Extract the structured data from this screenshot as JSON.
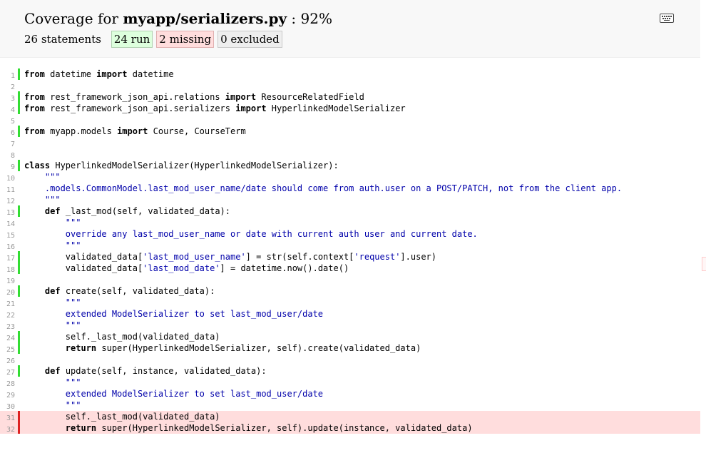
{
  "header": {
    "title_prefix": "Coverage for ",
    "file_name": "myapp/serializers.py",
    "title_suffix": " : 92%",
    "statements": "26 statements",
    "run_button": "24 run",
    "missing_button": "2 missing",
    "excluded_button": "0 excluded",
    "keyboard_icon": "keyboard-icon"
  },
  "colors": {
    "run_bar": "#33dd33",
    "missing_bar": "#dd2222",
    "missing_bg": "#ffdddd",
    "run_bg": "#ddffdd",
    "string": "#0000aa"
  },
  "lines": [
    {
      "n": "1",
      "status": "run",
      "segs": [
        [
          "k",
          "from"
        ],
        [
          "t",
          " datetime "
        ],
        [
          "k",
          "import"
        ],
        [
          "t",
          " datetime"
        ]
      ]
    },
    {
      "n": "2",
      "status": "",
      "segs": []
    },
    {
      "n": "3",
      "status": "run",
      "segs": [
        [
          "k",
          "from"
        ],
        [
          "t",
          " rest_framework_json_api.relations "
        ],
        [
          "k",
          "import"
        ],
        [
          "t",
          " ResourceRelatedField"
        ]
      ]
    },
    {
      "n": "4",
      "status": "run",
      "segs": [
        [
          "k",
          "from"
        ],
        [
          "t",
          " rest_framework_json_api.serializers "
        ],
        [
          "k",
          "import"
        ],
        [
          "t",
          " HyperlinkedModelSerializer"
        ]
      ]
    },
    {
      "n": "5",
      "status": "",
      "segs": []
    },
    {
      "n": "6",
      "status": "run",
      "segs": [
        [
          "k",
          "from"
        ],
        [
          "t",
          " myapp.models "
        ],
        [
          "k",
          "import"
        ],
        [
          "t",
          " Course, CourseTerm"
        ]
      ]
    },
    {
      "n": "7",
      "status": "",
      "segs": []
    },
    {
      "n": "8",
      "status": "",
      "segs": []
    },
    {
      "n": "9",
      "status": "run",
      "segs": [
        [
          "k",
          "class"
        ],
        [
          "t",
          " HyperlinkedModelSerializer(HyperlinkedModelSerializer):"
        ]
      ]
    },
    {
      "n": "10",
      "status": "",
      "segs": [
        [
          "t",
          "    "
        ],
        [
          "s",
          "\"\"\""
        ]
      ]
    },
    {
      "n": "11",
      "status": "",
      "segs": [
        [
          "t",
          "    "
        ],
        [
          "s",
          ".models.CommonModel.last_mod_user_name/date should come from auth.user on a POST/PATCH, not from the client app."
        ]
      ]
    },
    {
      "n": "12",
      "status": "",
      "segs": [
        [
          "t",
          "    "
        ],
        [
          "s",
          "\"\"\""
        ]
      ]
    },
    {
      "n": "13",
      "status": "run",
      "segs": [
        [
          "t",
          "    "
        ],
        [
          "k",
          "def"
        ],
        [
          "t",
          " _last_mod(self, validated_data):"
        ]
      ]
    },
    {
      "n": "14",
      "status": "",
      "segs": [
        [
          "t",
          "        "
        ],
        [
          "s",
          "\"\"\""
        ]
      ]
    },
    {
      "n": "15",
      "status": "",
      "segs": [
        [
          "t",
          "        "
        ],
        [
          "s",
          "override any last_mod_user_name or date with current auth user and current date."
        ]
      ]
    },
    {
      "n": "16",
      "status": "",
      "segs": [
        [
          "t",
          "        "
        ],
        [
          "s",
          "\"\"\""
        ]
      ]
    },
    {
      "n": "17",
      "status": "run",
      "segs": [
        [
          "t",
          "        validated_data["
        ],
        [
          "s",
          "'last_mod_user_name'"
        ],
        [
          "t",
          "] = str(self.context["
        ],
        [
          "s",
          "'request'"
        ],
        [
          "t",
          "].user)"
        ]
      ]
    },
    {
      "n": "18",
      "status": "run",
      "segs": [
        [
          "t",
          "        validated_data["
        ],
        [
          "s",
          "'last_mod_date'"
        ],
        [
          "t",
          "] = datetime.now().date()"
        ]
      ]
    },
    {
      "n": "19",
      "status": "",
      "segs": []
    },
    {
      "n": "20",
      "status": "run",
      "segs": [
        [
          "t",
          "    "
        ],
        [
          "k",
          "def"
        ],
        [
          "t",
          " create(self, validated_data):"
        ]
      ]
    },
    {
      "n": "21",
      "status": "",
      "segs": [
        [
          "t",
          "        "
        ],
        [
          "s",
          "\"\"\""
        ]
      ]
    },
    {
      "n": "22",
      "status": "",
      "segs": [
        [
          "t",
          "        "
        ],
        [
          "s",
          "extended ModelSerializer to set last_mod_user/date"
        ]
      ]
    },
    {
      "n": "23",
      "status": "",
      "segs": [
        [
          "t",
          "        "
        ],
        [
          "s",
          "\"\"\""
        ]
      ]
    },
    {
      "n": "24",
      "status": "run",
      "segs": [
        [
          "t",
          "        self._last_mod(validated_data)"
        ]
      ]
    },
    {
      "n": "25",
      "status": "run",
      "segs": [
        [
          "t",
          "        "
        ],
        [
          "k",
          "return"
        ],
        [
          "t",
          " super(HyperlinkedModelSerializer, self).create(validated_data)"
        ]
      ]
    },
    {
      "n": "26",
      "status": "",
      "segs": []
    },
    {
      "n": "27",
      "status": "run",
      "segs": [
        [
          "t",
          "    "
        ],
        [
          "k",
          "def"
        ],
        [
          "t",
          " update(self, instance, validated_data):"
        ]
      ]
    },
    {
      "n": "28",
      "status": "",
      "segs": [
        [
          "t",
          "        "
        ],
        [
          "s",
          "\"\"\""
        ]
      ]
    },
    {
      "n": "29",
      "status": "",
      "segs": [
        [
          "t",
          "        "
        ],
        [
          "s",
          "extended ModelSerializer to set last_mod_user/date"
        ]
      ]
    },
    {
      "n": "30",
      "status": "",
      "segs": [
        [
          "t",
          "        "
        ],
        [
          "s",
          "\"\"\""
        ]
      ]
    },
    {
      "n": "31",
      "status": "mis",
      "segs": [
        [
          "t",
          "        self._last_mod(validated_data)"
        ]
      ]
    },
    {
      "n": "32",
      "status": "mis",
      "segs": [
        [
          "t",
          "        "
        ],
        [
          "k",
          "return"
        ],
        [
          "t",
          " super(HyperlinkedModelSerializer, self).update(instance, validated_data)"
        ]
      ]
    },
    {
      "n": "",
      "status": "",
      "segs": []
    },
    {
      "n": "",
      "status": "",
      "segs": []
    }
  ]
}
